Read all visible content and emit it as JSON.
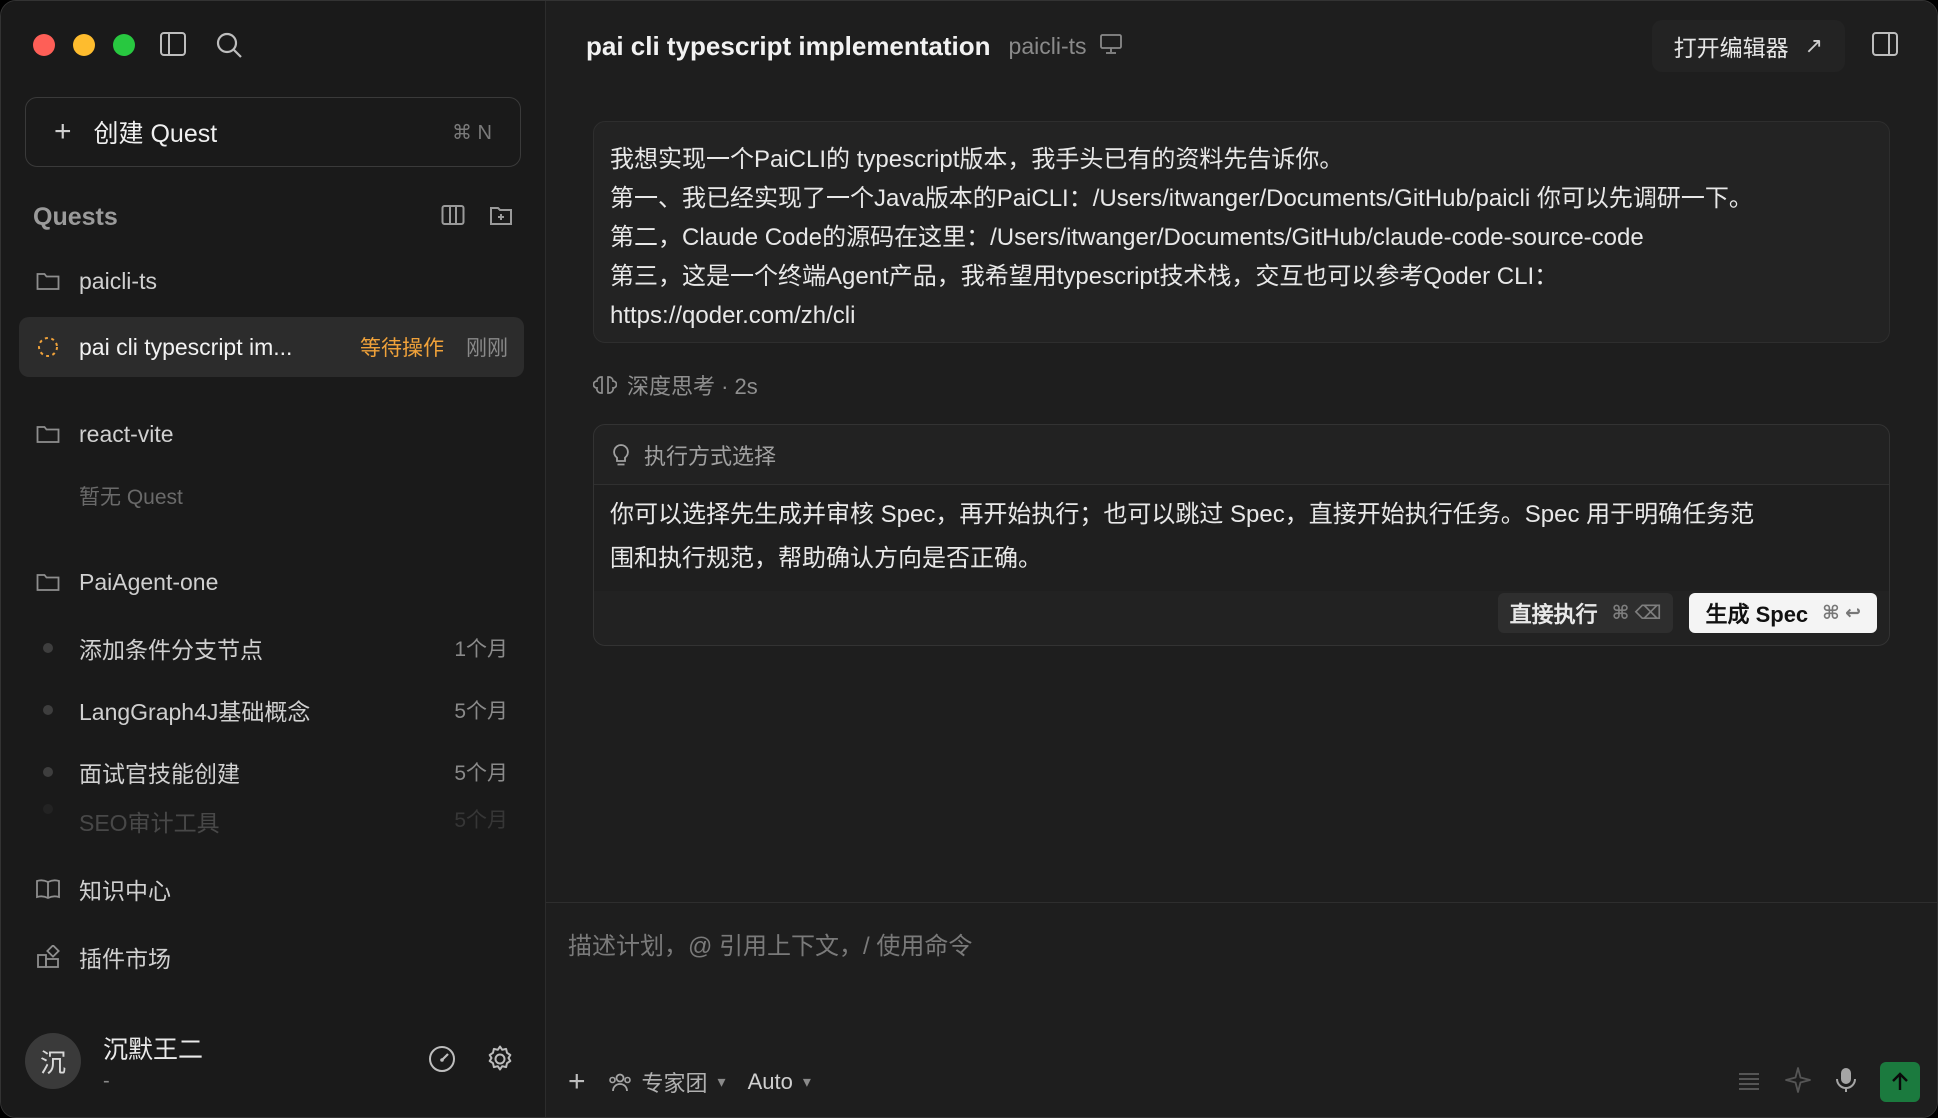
{
  "sidebar": {
    "create_label": "创建 Quest",
    "create_shortcut": "⌘ N",
    "quests_title": "Quests",
    "projects": [
      {
        "name": "paicli-ts"
      },
      {
        "name": "react-vite"
      },
      {
        "name": "PaiAgent-one"
      }
    ],
    "active_quest": {
      "title": "pai cli typescript im...",
      "status": "等待操作",
      "time": "刚刚"
    },
    "empty_label": "暂无 Quest",
    "quests": [
      {
        "title": "添加条件分支节点",
        "time": "1个月"
      },
      {
        "title": "LangGraph4J基础概念",
        "time": "5个月"
      },
      {
        "title": "面试官技能创建",
        "time": "5个月"
      },
      {
        "title": "SEO审计工具",
        "time": "5个月"
      }
    ],
    "knowledge_label": "知识中心",
    "plugins_label": "插件市场",
    "user": {
      "avatar_char": "沉",
      "name": "沉默王二",
      "sub": "-"
    }
  },
  "header": {
    "title": "pai cli typescript implementation",
    "project": "paicli-ts",
    "open_editor": "打开编辑器"
  },
  "message": {
    "lines": [
      "我想实现一个PaiCLI的 typescript版本，我手头已有的资料先告诉你。",
      "第一、我已经实现了一个Java版本的PaiCLI：/Users/itwanger/Documents/GitHub/paicli 你可以先调研一下。",
      "第二，Claude Code的源码在这里：/Users/itwanger/Documents/GitHub/claude-code-source-code",
      "第三，这是一个终端Agent产品，我希望用typescript技术栈，交互也可以参考Qoder CLI：",
      "https://qoder.com/zh/cli"
    ]
  },
  "thinking": "深度思考 · 2s",
  "choice": {
    "title": "执行方式选择",
    "body_line1": "你可以选择先生成并审核 Spec，再开始执行；也可以跳过 Spec，直接开始执行任务。Spec 用于明确任务范",
    "body_line2": "围和执行规范，帮助确认方向是否正确。",
    "direct_label": "直接执行",
    "direct_shortcut": "⌘ ⌫",
    "spec_label": "生成 Spec",
    "spec_shortcut": "⌘ ↩"
  },
  "composer": {
    "placeholder": "描述计划，@ 引用上下文，/ 使用命令",
    "team_label": "专家团",
    "mode_label": "Auto"
  },
  "colors": {
    "accent_status": "#f0a23a",
    "send_button": "#1b7a3e"
  }
}
